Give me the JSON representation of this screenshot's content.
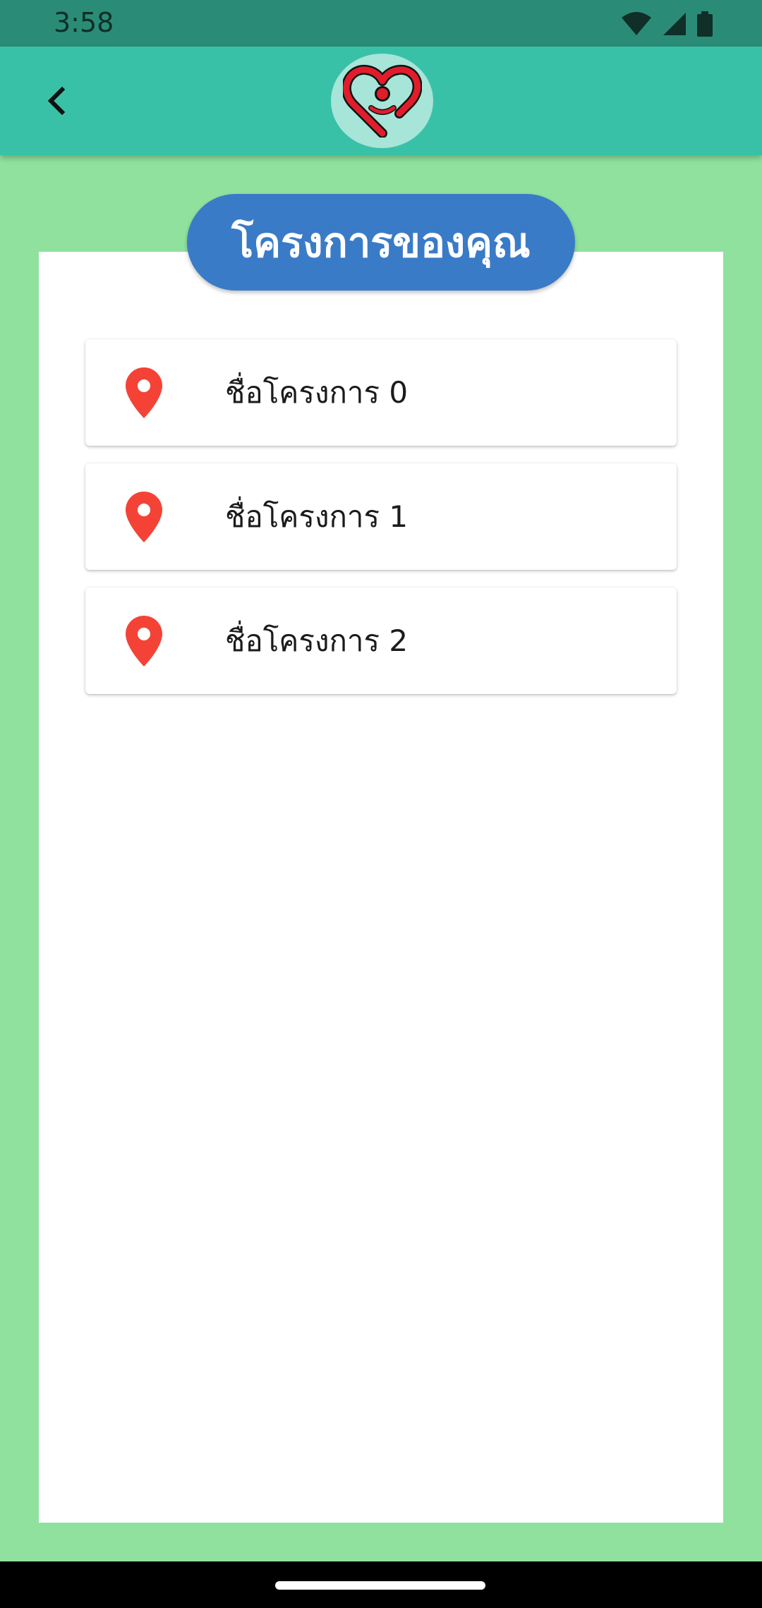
{
  "status_bar": {
    "time": "3:58",
    "icons": [
      "wifi-icon",
      "cellular-signal-icon",
      "battery-icon"
    ]
  },
  "app_bar": {
    "back_icon": "chevron-left-icon",
    "logo_icon": "heart-logo-icon"
  },
  "title": "โครงการของคุณ",
  "projects": [
    {
      "label": "ชื่อโครงการ 0",
      "icon": "map-pin-icon"
    },
    {
      "label": "ชื่อโครงการ 1",
      "icon": "map-pin-icon"
    },
    {
      "label": "ชื่อโครงการ 2",
      "icon": "map-pin-icon"
    }
  ],
  "colors": {
    "status_bar": "#2A8C77",
    "app_bar": "#39C1A8",
    "background": "#90E19E",
    "title_pill": "#3A7BC8",
    "pin": "#F44336"
  }
}
